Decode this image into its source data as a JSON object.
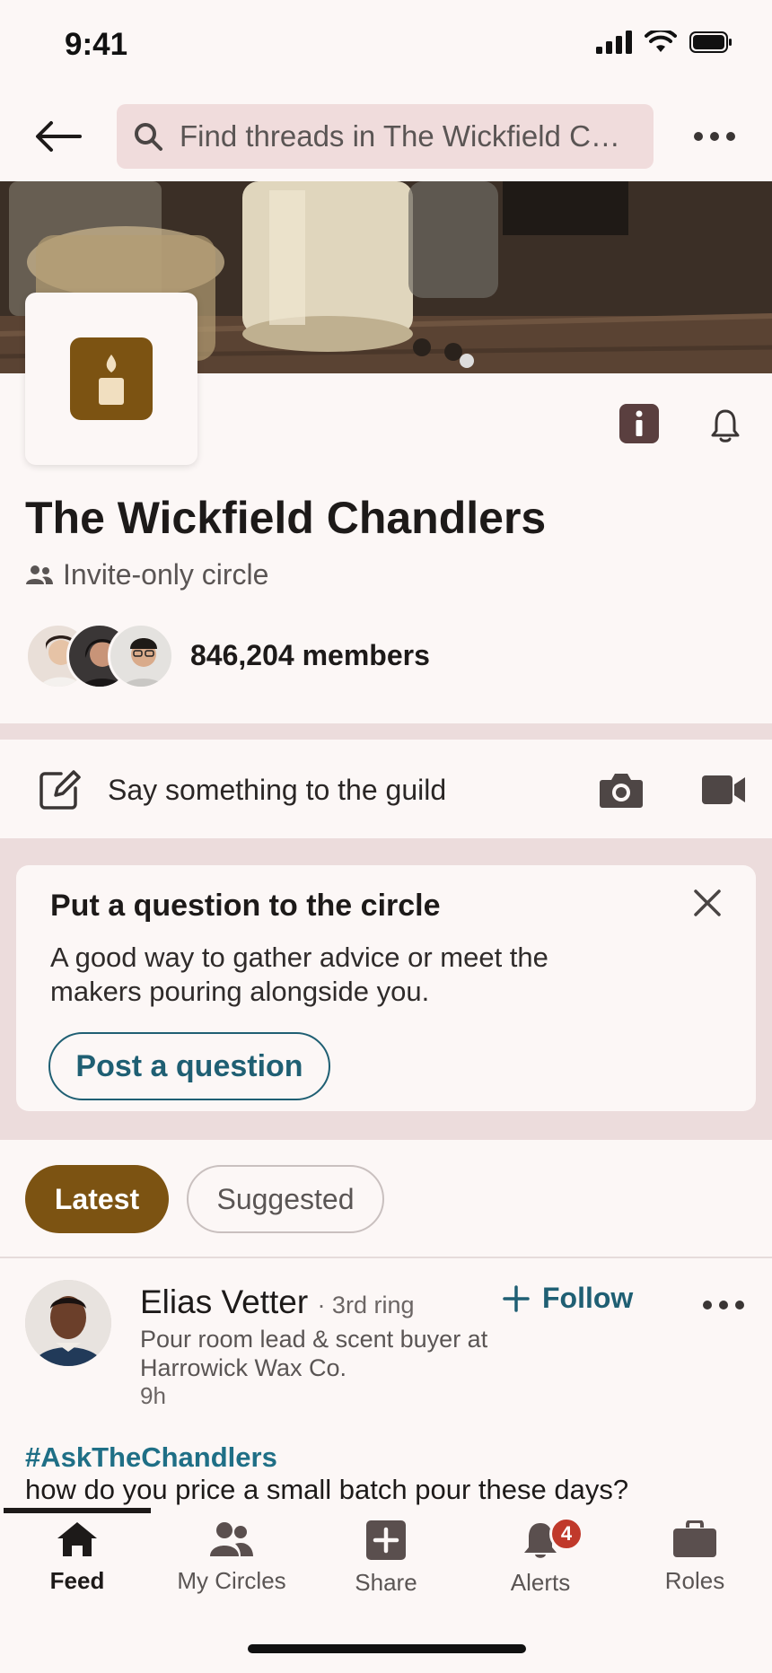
{
  "status_bar": {
    "time": "9:41"
  },
  "top_bar": {
    "search_placeholder": "Find threads in The Wickfield Ch..."
  },
  "group": {
    "name": "The Wickfield Chandlers",
    "privacy": "Invite-only circle",
    "members": "846,204 members",
    "brand_color": "#7c5312"
  },
  "composer": {
    "placeholder": "Say something to the guild"
  },
  "prompt_card": {
    "title": "Put a question to the circle",
    "body": "A good way to gather advice or meet the makers pouring alongside you.",
    "button": "Post a question"
  },
  "filters": {
    "active": "Latest",
    "other": "Suggested"
  },
  "post": {
    "author": "Elias Vetter",
    "degree": "· 3rd ring",
    "headline": "Pour room lead & scent buyer at Harrowick Wax Co.",
    "time": "9h",
    "follow": "Follow",
    "hashtag": "#AskTheChandlers",
    "body": "how do you price a small batch pour these days?"
  },
  "bottom_nav": {
    "items": [
      {
        "label": "Feed",
        "icon": "home-icon"
      },
      {
        "label": "My Circles",
        "icon": "people-icon"
      },
      {
        "label": "Share",
        "icon": "plus-square-icon"
      },
      {
        "label": "Alerts",
        "icon": "bell-icon",
        "badge": "4"
      },
      {
        "label": "Roles",
        "icon": "briefcase-icon"
      }
    ]
  },
  "colors": {
    "accent_link": "#1f5f73",
    "badge": "#c0392b"
  }
}
